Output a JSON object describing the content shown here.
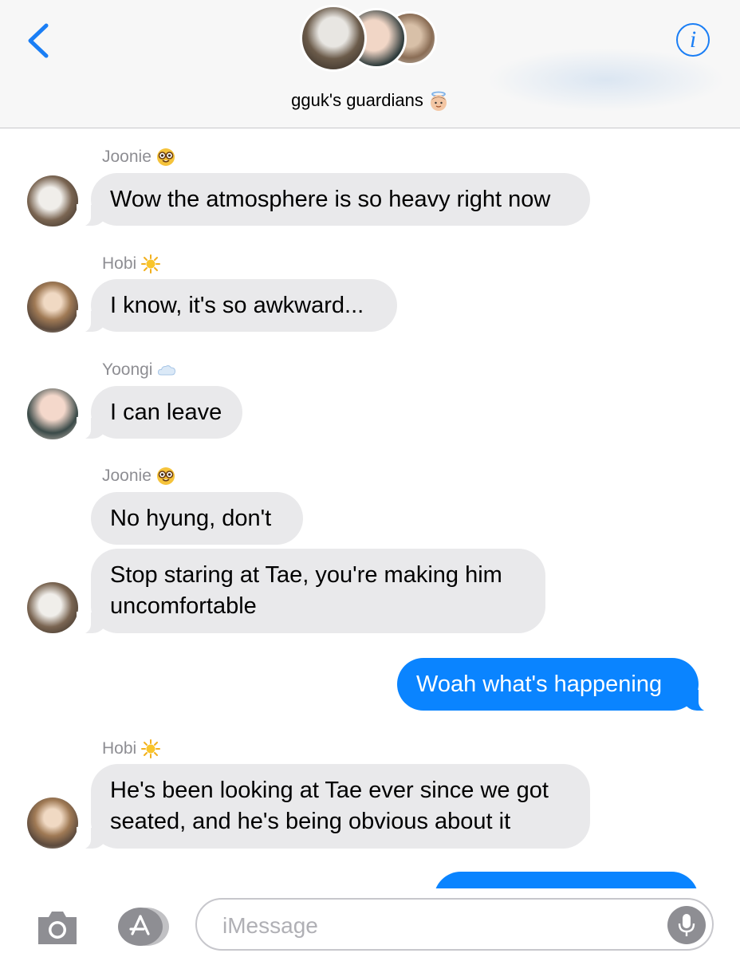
{
  "header": {
    "group_name": "gguk's guardians",
    "group_emoji": "angel-face-emoji",
    "back_icon": "chevron-left-icon",
    "info_icon": "info-icon",
    "info_glyph": "i"
  },
  "messages": [
    {
      "sender": "Joonie",
      "sender_emoji": "nerd-face-emoji",
      "text": "Wow the atmosphere is so heavy right now"
    },
    {
      "sender": "Hobi",
      "sender_emoji": "sun-emoji",
      "text": "I know, it's so awkward..."
    },
    {
      "sender": "Yoongi",
      "sender_emoji": "cloud-emoji",
      "text": "I can leave"
    },
    {
      "sender": "Joonie",
      "sender_emoji": "nerd-face-emoji",
      "text": "No hyung, don't"
    },
    {
      "text_line1": "Stop staring at Tae, you're making him",
      "text_line2": "uncomfortable"
    },
    {
      "from_me": true,
      "text": "Woah what's happening"
    },
    {
      "sender": "Hobi",
      "sender_emoji": "sun-emoji",
      "text_line1": "He's been looking at Tae ever since we got",
      "text_line2": "seated, and he's being obvious about it"
    }
  ],
  "composer": {
    "placeholder": "iMessage",
    "camera_icon": "camera-icon",
    "apps_icon": "app-store-icon",
    "mic_icon": "microphone-icon"
  },
  "colors": {
    "accent": "#0a84ff",
    "incoming_bubble": "#e9e9eb",
    "sender_label": "#8e8e93"
  }
}
